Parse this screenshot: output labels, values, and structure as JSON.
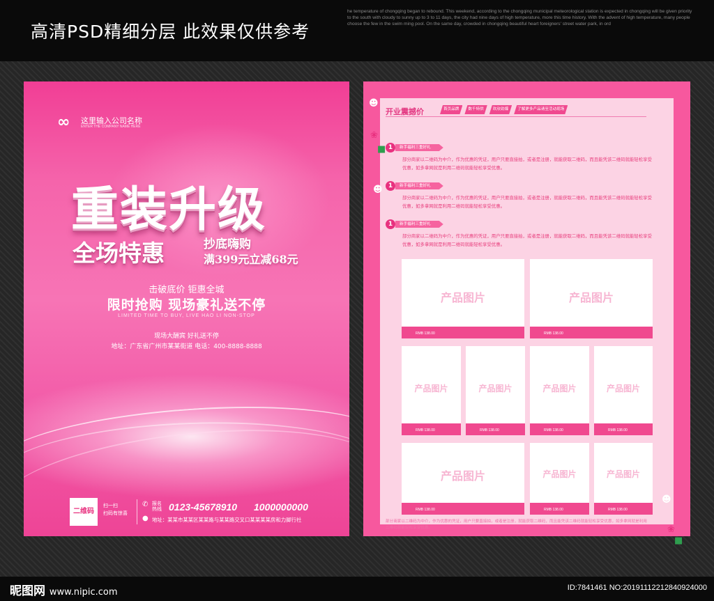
{
  "header": {
    "title": "高清PSD精细分层 此效果仅供参考",
    "english_text": "he temperature of chongqing began to rebound. This weekend, according to the chongqing municipal meteorological station is expected in chongqing will be given priority to the south with cloudy to sunny up to 3 to 11 days, the city had nine days of high temperature, more this time history. With the advent of high temperature, many people choose the few in the swim ming pool. On the same day, crowded in chongqing beautiful heart foreigners' street water park, in ord"
  },
  "left_poster": {
    "brand_name": "这里输入公司名称",
    "brand_sub": "ENTER THE COMPANY NAME HERE",
    "headline": "重装升级",
    "subheadline": "全场特惠",
    "promo_line1": "抄底嗨购",
    "promo_line2": "满399元立减68元",
    "tagline1": "击破底价 钜惠全城",
    "tagline2": "限时抢购 现场豪礼送不停",
    "tagline3": "LIMITED TIME TO BUY, LIVE HAO LI NON-STOP",
    "tagline4": "现场大酬宾 好礼送不停",
    "address_line": "地址：广东省广州市某某街道 电话：400-8888-8888",
    "qr_label": "二维码",
    "scan_line1": "扫一扫",
    "scan_line2": "扫码有惊喜",
    "hotline_label1": "报名",
    "hotline_label2": "热线",
    "phone1": "0123-45678910",
    "phone2": "1000000000",
    "address_footer": "地址：某某市某某区某某路与某某路交叉口某某某某房和力脚行社"
  },
  "right_poster": {
    "section_title": "开业震撼价",
    "tabs": [
      "首页品牌",
      "数千特供",
      "欢欣劲爆",
      "了解更多产品请至活动现场"
    ],
    "items": [
      {
        "num": "1",
        "tag": "新手福利三重好礼",
        "text": "部分商家以二维码为中介，作为优惠的凭证，用户只要直接拍，或者是注册，就能获取二维码，而且能凭该二维码就能轻松享受优惠，如多拿网就是利用二维码就能轻松享受优惠。"
      },
      {
        "num": "1",
        "tag": "新手福利三重好礼",
        "text": "部分商家以二维码为中介，作为优惠的凭证，用户只要直接拍，或者是注册，就能获取二维码，而且能凭该二维码就能轻松享受优惠，如多拿网就是利用二维码就能轻松享受优惠。"
      },
      {
        "num": "1",
        "tag": "新手福利三重好礼",
        "text": "部分商家以二维码为中介，作为优惠的凭证，用户只要直接拍，或者是注册，就能获取二维码，而且能凭该二维码就能轻松享受优惠，如多拿网就是利用二维码就能轻松享受优惠。"
      }
    ],
    "product_label": "产品图片",
    "price_label": "RMB 138.00",
    "footer_text": "部分商家以二维码为中介，作为优惠的凭证，用户只要直接拍，或者是注册，就能获取二维码，而且能凭该二维码就能轻松享受优惠，如多拿网就是利用二维码就能轻松享受优惠。"
  },
  "bottom": {
    "logo_text": "昵图网",
    "logo_url": "www.nipic.com",
    "id_text": "ID:7841461 NO:20191112212840924000"
  },
  "colors": {
    "poster_pink": "#f13e95",
    "frame_pink": "#f7589e",
    "panel_light_pink": "#fcd3e4",
    "accent_magenta": "#e8317f"
  }
}
